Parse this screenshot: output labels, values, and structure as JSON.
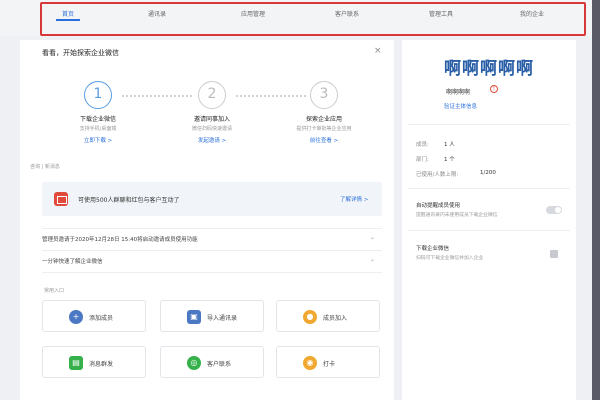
{
  "nav": {
    "tabs": [
      {
        "label": "首页"
      },
      {
        "label": "通讯录"
      },
      {
        "label": "应用管理"
      },
      {
        "label": "客户联系"
      },
      {
        "label": "管理工具"
      },
      {
        "label": "我的企业"
      }
    ],
    "active_index": 0
  },
  "main": {
    "title": "看看，开始探索企业微信",
    "close_icon": "close-icon",
    "steps": [
      {
        "number": "1",
        "title": "下载企业微信",
        "desc": "支持手机/桌面端",
        "link": "立即下载 >"
      },
      {
        "number": "2",
        "title": "邀请同事加入",
        "desc": "微信扫码快速邀请",
        "link": "发起邀请 >"
      },
      {
        "number": "3",
        "title": "探索企业应用",
        "desc": "提供打卡审批等企业应用",
        "link": "前往查看 >"
      }
    ],
    "notice_label": "咨询 | 新消息",
    "banner": {
      "icon": "gift-icon",
      "text": "可使用500人群聊和红包与客户互动了",
      "link": "了解详情 >"
    },
    "rows": [
      "管理员邀请于2020年12月28日 15:40将启动邀请成员使用功能",
      "一分钟快速了解企业微信"
    ],
    "quick_label": "常用入口",
    "quick": [
      {
        "label": "添加成员",
        "icon": "add-user-icon",
        "color": "#4a78c2"
      },
      {
        "label": "导入通讯录",
        "icon": "import-icon",
        "color": "#4a78c2"
      },
      {
        "label": "成员加入",
        "icon": "members-icon",
        "color": "#f0a830"
      },
      {
        "label": "消息群发",
        "icon": "broadcast-icon",
        "color": "#35b04a"
      },
      {
        "label": "客户联系",
        "icon": "customer-icon",
        "color": "#35b04a"
      },
      {
        "label": "打卡",
        "icon": "location-icon",
        "color": "#f0a830"
      }
    ]
  },
  "side": {
    "brand": "啊啊啊啊啊",
    "company_name": "啊啊啊啊",
    "verify_link": "验证主体信息",
    "stats": [
      {
        "key": "成员:",
        "value": "1 人"
      },
      {
        "key": "部门:",
        "value": "1 个"
      },
      {
        "key": "已使用/人数上限:",
        "value": "1/200"
      }
    ],
    "settings": [
      {
        "title": "自动提醒成员使用",
        "desc": "提醒通讯录内未使用成员下载企业微信"
      },
      {
        "title": "下载企业微信",
        "desc": "扫码可下载企业微信并加入企业"
      }
    ]
  },
  "colors": {
    "accent": "#2a6fdb",
    "highlight_border": "#d9383a"
  }
}
